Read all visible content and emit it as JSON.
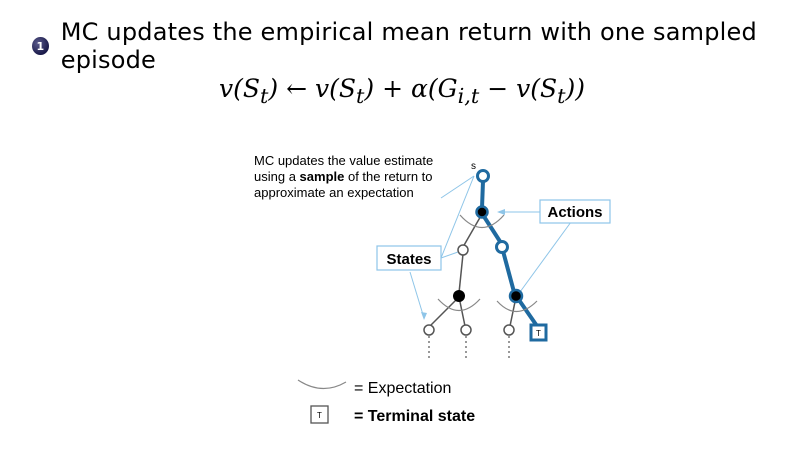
{
  "slide": {
    "bullet_number": "1",
    "bullet_text": "MC updates the empirical mean return with one sampled episode",
    "equation": {
      "lhs": "v(S",
      "lhs_sub": "t",
      "lhs_close": ")",
      "arrow": " ← ",
      "rhs_v": "v(S",
      "rhs_v_sub": "t",
      "rhs_v_close": ")",
      "plus": " + ",
      "alpha": "α(G",
      "g_sub": "i,t",
      "minus": " − ",
      "v2": "v(S",
      "v2_sub": "t",
      "v2_close": "))"
    }
  },
  "diagram": {
    "caption_lines": [
      "MC updates the value estimate",
      "using a ",
      "sample",
      " of the return to",
      "approximate an expectation"
    ],
    "root_label": "s",
    "actions_label": "Actions",
    "states_label": "States",
    "terminal_box_label": "T",
    "legend_expectation": "= Expectation",
    "legend_terminal": "= Terminal state",
    "colors": {
      "highlight": "#1f6aa0",
      "callout_line": "#8ec5e8",
      "node_dark": "#000000"
    }
  }
}
